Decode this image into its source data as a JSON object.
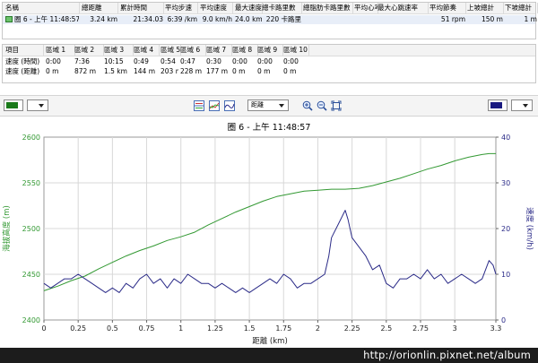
{
  "lap_table": {
    "columns": [
      "名稱",
      "總距離",
      "累計時間",
      "平均步速",
      "平均速度",
      "最大速度",
      "總卡路里數",
      "總脂肪卡路里數",
      "平均心率",
      "最大心跳速率",
      "平均節奏",
      "上坡總計",
      "下坡總計"
    ],
    "row": [
      "圈 6 - 上午 11:48:57",
      "3.24 km",
      "21:34.03",
      "6:39 /km",
      "9.0 km/h",
      "24.0 km/h",
      "220 卡路里",
      "",
      "",
      "",
      "51 rpm",
      "150 m",
      "1 m"
    ]
  },
  "zone_table": {
    "columns": [
      "項目",
      "區域 1",
      "區域 2",
      "區域 3",
      "區域 4",
      "區域 5",
      "區域 6",
      "區域 7",
      "區域 8",
      "區域 9",
      "區域 10"
    ],
    "rows": [
      [
        "速度 (時間)",
        "0:00",
        "7:36",
        "10:15",
        "0:49",
        "0:54",
        "0:47",
        "0:30",
        "0:00",
        "0:00",
        "0:00"
      ],
      [
        "速度 (距離)",
        "0 m",
        "872 m",
        "1.5 km",
        "144 m",
        "203 m",
        "228 m",
        "177 m",
        "0 m",
        "0 m",
        "0 m"
      ]
    ]
  },
  "toolbar": {
    "color1": "#1a7a1a",
    "color2": "#1a1a80",
    "xaxis_select": "距離",
    "icons": [
      "chart-stacked-icon",
      "chart-overlay-icon",
      "chart-smooth-icon",
      "zoom-in-icon",
      "zoom-out-icon",
      "zoom-fit-icon"
    ]
  },
  "watermark": "http://orionlin.pixnet.net/album",
  "colors": {
    "elevation": "#339933",
    "speed": "#2b2b88",
    "grid": "#d8d8d8"
  },
  "chart_data": {
    "type": "line",
    "title": "圈 6 - 上午 11:48:57",
    "xlabel": "距離 (km)",
    "ylabel_left": "海拔高度 (m)",
    "ylabel_right": "速度 (km/h)",
    "xlim": [
      0,
      3.3
    ],
    "ylim_left": [
      2400,
      2600
    ],
    "ylim_right": [
      0,
      40
    ],
    "xticks": [
      "0",
      "0.25",
      "0.5",
      "0.75",
      "1",
      "1.25",
      "1.5",
      "1.75",
      "2",
      "2.25",
      "2.5",
      "2.75",
      "3",
      "3.3"
    ],
    "yticks_left": [
      "2400",
      "2450",
      "2500",
      "2550",
      "2600"
    ],
    "yticks_right": [
      "0",
      "10",
      "20",
      "30",
      "40"
    ],
    "grid": true,
    "series": [
      {
        "name": "海拔高度",
        "axis": "left",
        "x": [
          0,
          0.1,
          0.2,
          0.3,
          0.4,
          0.5,
          0.6,
          0.7,
          0.8,
          0.9,
          1.0,
          1.1,
          1.2,
          1.3,
          1.4,
          1.5,
          1.6,
          1.7,
          1.8,
          1.9,
          2.0,
          2.1,
          2.2,
          2.3,
          2.4,
          2.5,
          2.6,
          2.7,
          2.8,
          2.9,
          3.0,
          3.1,
          3.2,
          3.25,
          3.3
        ],
        "values": [
          2432,
          2437,
          2443,
          2448,
          2456,
          2463,
          2470,
          2476,
          2481,
          2487,
          2491,
          2496,
          2504,
          2511,
          2518,
          2524,
          2530,
          2535,
          2538,
          2541,
          2542,
          2543,
          2543,
          2544,
          2547,
          2551,
          2555,
          2560,
          2565,
          2569,
          2574,
          2578,
          2581,
          2582,
          2582
        ]
      },
      {
        "name": "速度",
        "axis": "right",
        "x": [
          0,
          0.05,
          0.1,
          0.15,
          0.2,
          0.25,
          0.3,
          0.35,
          0.4,
          0.45,
          0.5,
          0.55,
          0.6,
          0.65,
          0.7,
          0.75,
          0.8,
          0.85,
          0.9,
          0.95,
          1.0,
          1.05,
          1.1,
          1.15,
          1.2,
          1.25,
          1.3,
          1.35,
          1.4,
          1.45,
          1.5,
          1.55,
          1.6,
          1.65,
          1.7,
          1.75,
          1.8,
          1.85,
          1.9,
          1.95,
          2.0,
          2.05,
          2.08,
          2.1,
          2.15,
          2.2,
          2.22,
          2.25,
          2.3,
          2.35,
          2.4,
          2.45,
          2.5,
          2.55,
          2.6,
          2.65,
          2.7,
          2.75,
          2.8,
          2.85,
          2.9,
          2.95,
          3.0,
          3.05,
          3.1,
          3.15,
          3.2,
          3.25,
          3.28,
          3.3
        ],
        "values": [
          8,
          7,
          8,
          9,
          9,
          10,
          9,
          8,
          7,
          6,
          7,
          6,
          8,
          7,
          9,
          10,
          8,
          9,
          7,
          9,
          8,
          10,
          9,
          8,
          8,
          7,
          8,
          7,
          6,
          7,
          6,
          7,
          8,
          9,
          8,
          10,
          9,
          7,
          8,
          8,
          9,
          10,
          14,
          18,
          21,
          24,
          22,
          18,
          16,
          14,
          11,
          12,
          8,
          7,
          9,
          9,
          10,
          9,
          11,
          9,
          10,
          8,
          9,
          10,
          9,
          8,
          9,
          13,
          12,
          10
        ]
      }
    ]
  }
}
